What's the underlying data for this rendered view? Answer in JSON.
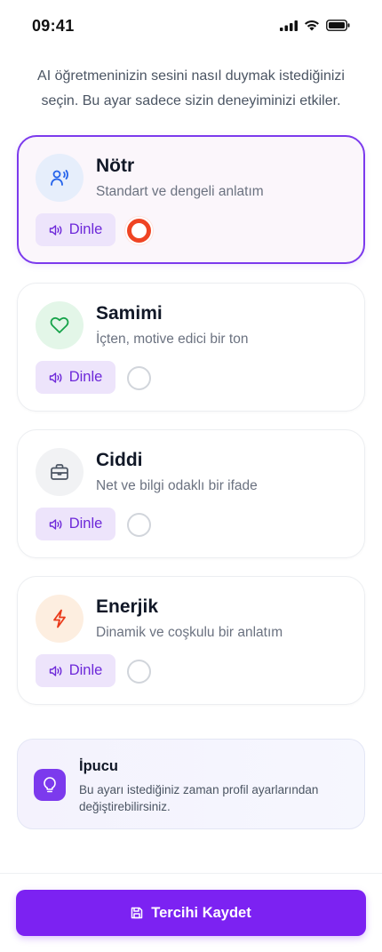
{
  "status_bar": {
    "time": "09:41"
  },
  "intro_text": "AI öğretmeninizin sesini nasıl duymak istediğinizi seçin. Bu ayar sadece sizin deneyiminizi etkiler.",
  "options": [
    {
      "title": "Nötr",
      "description": "Standart ve dengeli anlatım",
      "listen_label": "Dinle",
      "icon": "user-voice-icon",
      "selected": true
    },
    {
      "title": "Samimi",
      "description": "İçten, motive edici bir ton",
      "listen_label": "Dinle",
      "icon": "heart-icon",
      "selected": false
    },
    {
      "title": "Ciddi",
      "description": "Net ve bilgi odaklı bir ifade",
      "listen_label": "Dinle",
      "icon": "briefcase-icon",
      "selected": false
    },
    {
      "title": "Enerjik",
      "description": "Dinamik ve coşkulu bir anlatım",
      "listen_label": "Dinle",
      "icon": "lightning-icon",
      "selected": false
    }
  ],
  "tip": {
    "title": "İpucu",
    "text": "Bu ayarı istediğiniz zaman profil ayarlarından değiştirebilirsiniz."
  },
  "save_button": {
    "label": "Tercihi Kaydet"
  },
  "colors": {
    "accent": "#7c3aed",
    "button": "#7c22f2",
    "radio_selected": "#ef4423",
    "neutral_icon_bg": "#e6eefb",
    "samimi_icon_bg": "#e3f6e8",
    "ciddi_icon_bg": "#f1f2f4",
    "enerjik_icon_bg": "#fdeee0"
  }
}
